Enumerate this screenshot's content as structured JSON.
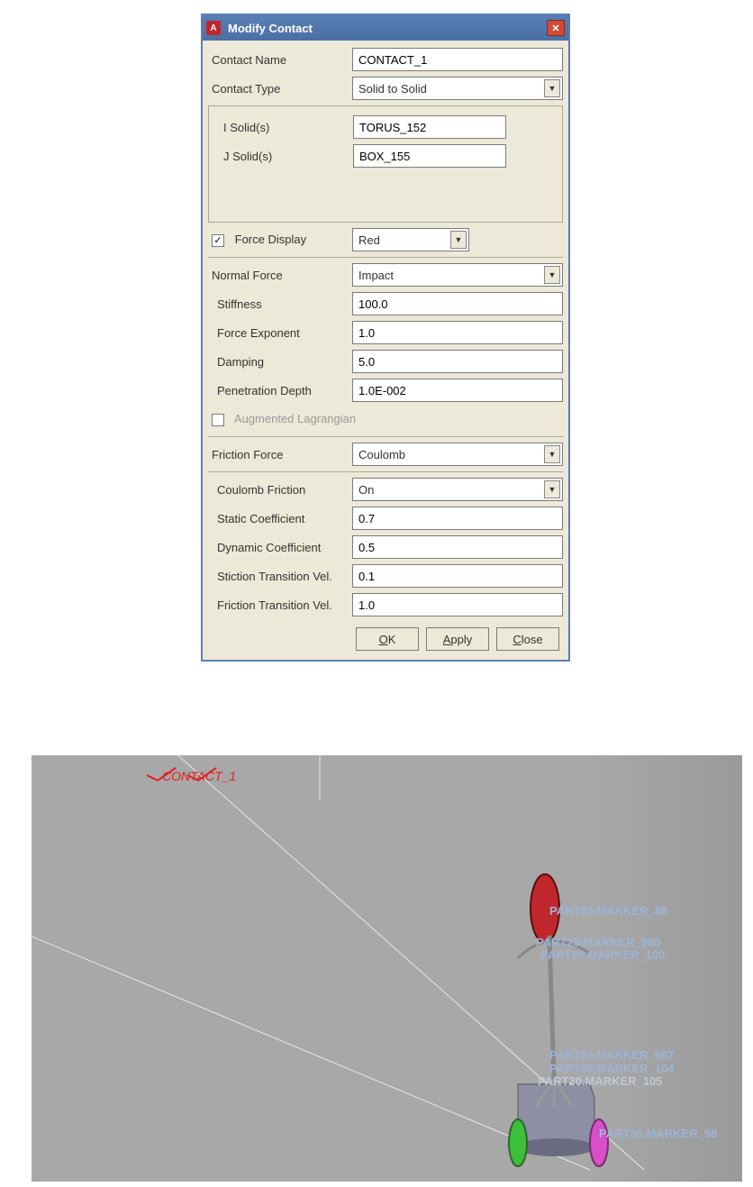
{
  "dialog": {
    "title": "Modify Contact",
    "contact_name_label": "Contact Name",
    "contact_name_value": "CONTACT_1",
    "contact_type_label": "Contact Type",
    "contact_type_value": "Solid to Solid",
    "i_solid_label": "I Solid(s)",
    "i_solid_value": "TORUS_152",
    "j_solid_label": "J Solid(s)",
    "j_solid_value": "BOX_155",
    "force_display_label": "Force Display",
    "force_display_checked": true,
    "force_display_color": "Red",
    "normal_force_label": "Normal Force",
    "normal_force_value": "Impact",
    "stiffness_label": "Stiffness",
    "stiffness_value": "100.0",
    "force_exponent_label": "Force Exponent",
    "force_exponent_value": "1.0",
    "damping_label": "Damping",
    "damping_value": "5.0",
    "penetration_label": "Penetration Depth",
    "penetration_value": "1.0E-002",
    "aug_lagrangian_label": "Augmented Lagrangian",
    "aug_lagrangian_checked": false,
    "friction_force_label": "Friction Force",
    "friction_force_value": "Coulomb",
    "coulomb_friction_label": "Coulomb Friction",
    "coulomb_friction_value": "On",
    "static_coeff_label": "Static Coefficient",
    "static_coeff_value": "0.7",
    "dynamic_coeff_label": "Dynamic Coefficient",
    "dynamic_coeff_value": "0.5",
    "stiction_vel_label": "Stiction Transition Vel.",
    "stiction_vel_value": "0.1",
    "friction_vel_label": "Friction Transition Vel.",
    "friction_vel_value": "1.0",
    "ok_label": "OK",
    "apply_label": "Apply",
    "close_label": "Close"
  },
  "viewport": {
    "contact_annotation": "CONTACT_1",
    "marker_labels": [
      "PART28.MARKER_88",
      "PART29.MARKER_980",
      "PART20.MARKER_100",
      "PART28.MARKER_987",
      "PART29.MARKER_104",
      "PART20.MARKER_105",
      "PART30.MARKER_98"
    ]
  }
}
